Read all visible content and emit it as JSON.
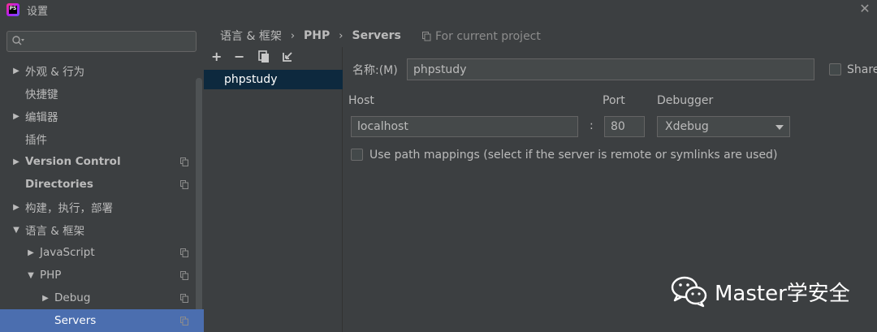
{
  "window": {
    "title": "设置",
    "app_icon_text": "PS"
  },
  "search": {
    "placeholder": ""
  },
  "tree": [
    {
      "label": "外观 & 行为",
      "arrow": "▶",
      "indent": 0,
      "bold": false,
      "copy": false
    },
    {
      "label": "快捷键",
      "arrow": "",
      "indent": 0,
      "bold": false,
      "copy": false
    },
    {
      "label": "编辑器",
      "arrow": "▶",
      "indent": 0,
      "bold": false,
      "copy": false
    },
    {
      "label": "插件",
      "arrow": "",
      "indent": 0,
      "bold": false,
      "copy": false
    },
    {
      "label": "Version Control",
      "arrow": "▶",
      "indent": 0,
      "bold": true,
      "copy": true
    },
    {
      "label": "Directories",
      "arrow": "",
      "indent": 0,
      "bold": true,
      "copy": true
    },
    {
      "label": "构建，执行，部署",
      "arrow": "▶",
      "indent": 0,
      "bold": false,
      "copy": false
    },
    {
      "label": "语言 & 框架",
      "arrow": "▼",
      "indent": 0,
      "bold": false,
      "copy": false
    },
    {
      "label": "JavaScript",
      "arrow": "▶",
      "indent": 1,
      "bold": false,
      "copy": true
    },
    {
      "label": "PHP",
      "arrow": "▼",
      "indent": 1,
      "bold": false,
      "copy": true
    },
    {
      "label": "Debug",
      "arrow": "▶",
      "indent": 2,
      "bold": false,
      "copy": true
    },
    {
      "label": "Servers",
      "arrow": "",
      "indent": 2,
      "bold": false,
      "copy": true,
      "selected": true
    }
  ],
  "breadcrumb": {
    "part1": "语言 & 框架",
    "sep": "›",
    "part2": "PHP",
    "part3": "Servers"
  },
  "scope": {
    "label": "For current project"
  },
  "toolbar": {
    "add": "+",
    "remove": "−",
    "copy": "copy",
    "import": "import"
  },
  "servers": {
    "items": [
      "phpstudy"
    ]
  },
  "form": {
    "name_label": "名称:(M)",
    "name_value": "phpstudy",
    "share_label": "Share",
    "host_label": "Host",
    "host_value": "localhost",
    "colon": ":",
    "port_label": "Port",
    "port_value": "80",
    "debugger_label": "Debugger",
    "debugger_value": "Xdebug",
    "path_mappings_label": "Use path mappings (select if the server is remote or symlinks are used)"
  },
  "watermark": {
    "text": "Master学安全"
  }
}
